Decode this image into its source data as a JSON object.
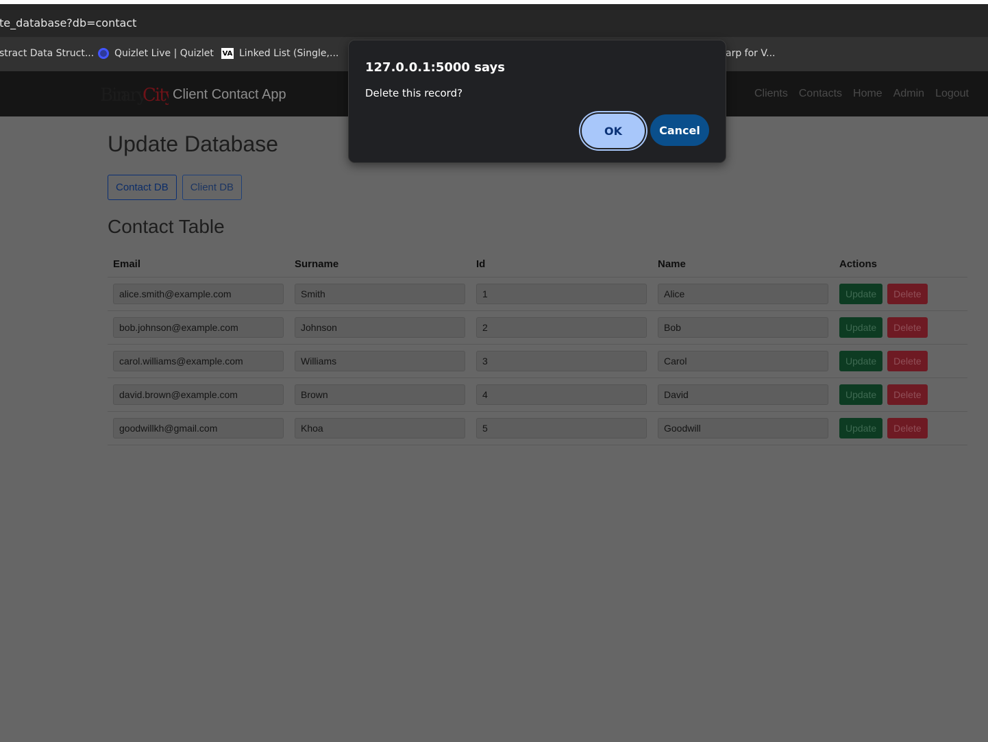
{
  "browser": {
    "url": "te_database?db=contact",
    "bookmarks": [
      {
        "label": "stract Data Struct...",
        "icon": "none"
      },
      {
        "label": "Quizlet Live | Quizlet",
        "icon": "quizlet-icon"
      },
      {
        "label": "Linked List (Single,...",
        "icon": "visualgo-icon",
        "icon_text": "VA"
      },
      {
        "label": "arp for V...",
        "icon": "none"
      }
    ]
  },
  "navbar": {
    "logo_part1": "BinaryCity",
    "brand": "Client Contact App",
    "links": [
      "Clients",
      "Contacts",
      "Home",
      "Admin",
      "Logout"
    ]
  },
  "page": {
    "title": "Update Database",
    "db_buttons": [
      "Contact DB",
      "Client DB"
    ],
    "section_title": "Contact Table"
  },
  "table": {
    "headers": [
      "Email",
      "Surname",
      "Id",
      "Name",
      "Actions"
    ],
    "rows": [
      {
        "email": "alice.smith@example.com",
        "surname": "Smith",
        "id": "1",
        "name": "Alice"
      },
      {
        "email": "bob.johnson@example.com",
        "surname": "Johnson",
        "id": "2",
        "name": "Bob"
      },
      {
        "email": "carol.williams@example.com",
        "surname": "Williams",
        "id": "3",
        "name": "Carol"
      },
      {
        "email": "david.brown@example.com",
        "surname": "Brown",
        "id": "4",
        "name": "David"
      },
      {
        "email": "goodwillkh@gmail.com",
        "surname": "Khoa",
        "id": "5",
        "name": "Goodwill"
      }
    ],
    "update_label": "Update",
    "delete_label": "Delete"
  },
  "dialog": {
    "title": "127.0.0.1:5000 says",
    "message": "Delete this record?",
    "ok_label": "OK",
    "cancel_label": "Cancel"
  },
  "colors": {
    "overlay_background": "#666666",
    "update_button": "#0d3b22",
    "delete_button": "#6e1a23",
    "dialog_ok": "#a8c7fa",
    "dialog_cancel": "#0a4f8c"
  }
}
